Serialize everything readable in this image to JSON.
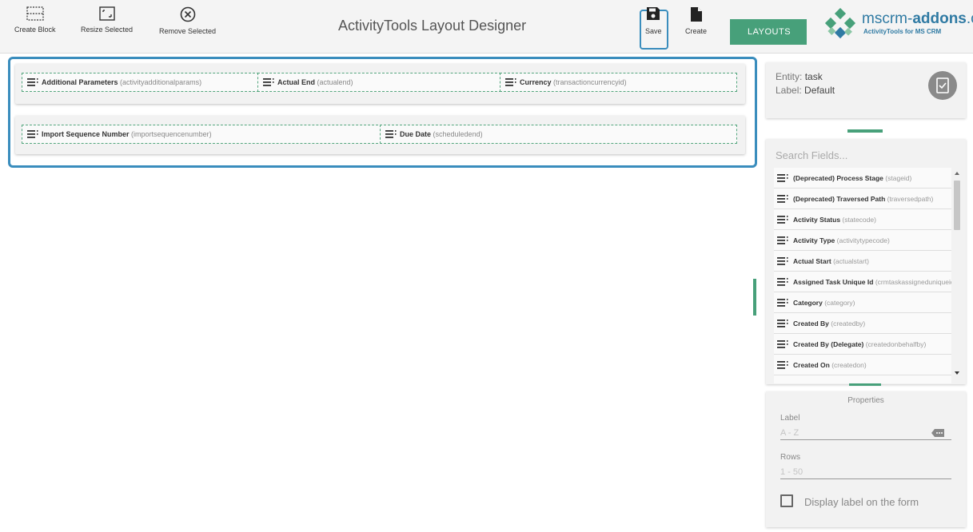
{
  "toolbar": {
    "create_block": "Create Block",
    "resize_selected": "Resize Selected",
    "remove_selected": "Remove Selected",
    "save": "Save",
    "create": "Create",
    "layouts": "LAYOUTS"
  },
  "app_title": "ActivityTools Layout Designer",
  "logo": {
    "name_prefix": "mscrm-",
    "name_bold": "addons",
    "name_suffix": ".c",
    "tagline": "ActivityTools for MS CRM"
  },
  "layout_rows": [
    {
      "cells": [
        {
          "label": "Additional Parameters",
          "schema": "(activityadditionalparams)"
        },
        {
          "label": "Actual End",
          "schema": "(actualend)"
        },
        {
          "label": "Currency",
          "schema": "(transactioncurrencyid)"
        }
      ]
    },
    {
      "cells": [
        {
          "label": "Import Sequence Number",
          "schema": "(importsequencenumber)"
        },
        {
          "label": "Due Date",
          "schema": "(scheduledend)"
        }
      ]
    }
  ],
  "entity": {
    "entity_prefix": "Entity:",
    "entity_value": "task",
    "label_prefix": "Label:",
    "label_value": "Default"
  },
  "fields": {
    "search_placeholder": "Search Fields...",
    "items": [
      {
        "label": "(Deprecated) Process Stage",
        "schema": "(stageid)"
      },
      {
        "label": "(Deprecated) Traversed Path",
        "schema": "(traversedpath)"
      },
      {
        "label": "Activity Status",
        "schema": "(statecode)"
      },
      {
        "label": "Activity Type",
        "schema": "(activitytypecode)"
      },
      {
        "label": "Actual Start",
        "schema": "(actualstart)"
      },
      {
        "label": "Assigned Task Unique Id",
        "schema": "(crmtaskassigneduniqueid)"
      },
      {
        "label": "Category",
        "schema": "(category)"
      },
      {
        "label": "Created By",
        "schema": "(createdby)"
      },
      {
        "label": "Created By (Delegate)",
        "schema": "(createdonbehalfby)"
      },
      {
        "label": "Created On",
        "schema": "(createdon)"
      }
    ]
  },
  "properties": {
    "title": "Properties",
    "label_label": "Label",
    "label_placeholder": "A - Z",
    "rows_label": "Rows",
    "rows_placeholder": "1 - 50",
    "display_label_text": "Display label on the form",
    "display_label_checked": false
  },
  "colors": {
    "accent_green": "#47a07a",
    "highlight_blue": "#3a8dbd"
  }
}
